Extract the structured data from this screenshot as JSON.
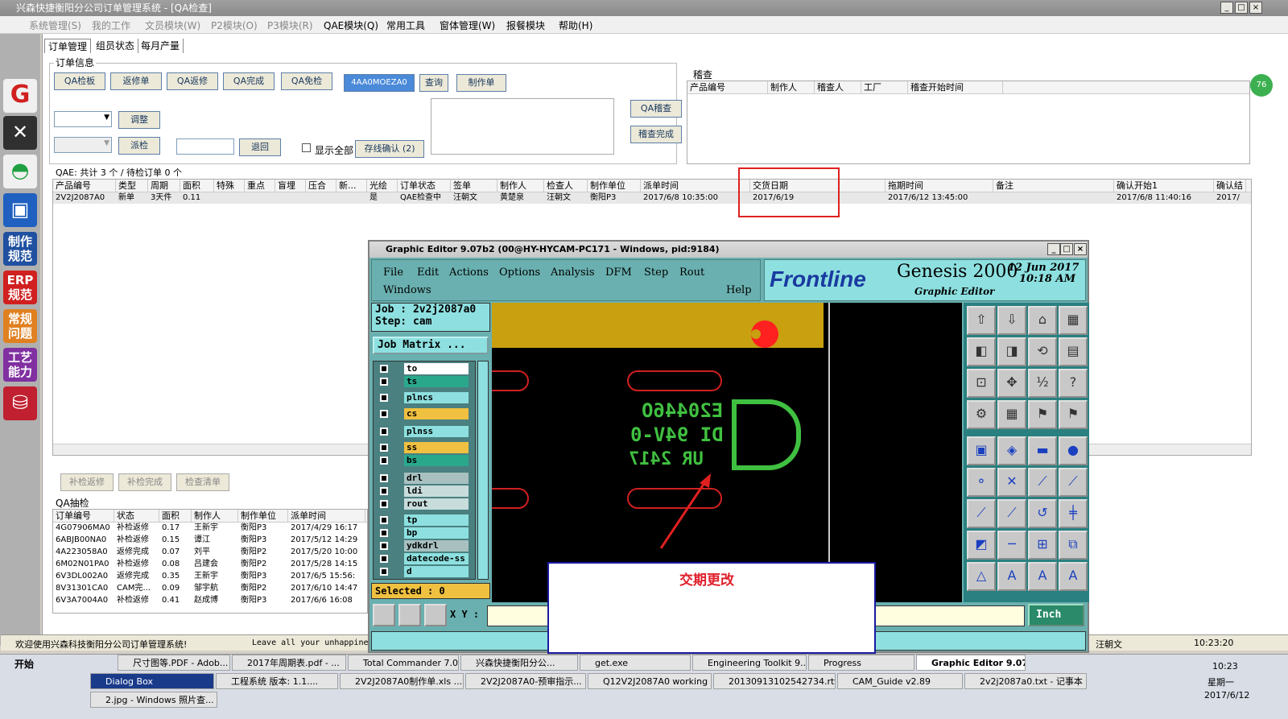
{
  "window": {
    "title": "兴森快捷衡阳分公司订单管理系统 - [QA检查]",
    "menus": [
      "系统管理(S)",
      "我的工作",
      "文员模块(W)",
      "P2模块(O)",
      "P3模块(R)",
      "QAE模块(Q)",
      "常用工具",
      "窗体管理(W)",
      "报餐模块",
      "帮助(H)"
    ]
  },
  "left_toolbar": {
    "items": [
      "制作规范",
      "ERP规范",
      "常规问题",
      "工艺能力"
    ]
  },
  "tabs": [
    "订单管理",
    "组员状态",
    "每月产量"
  ],
  "order_info": {
    "group_label": "订单信息",
    "buttons": [
      "QA检板",
      "返修单",
      "QA返修",
      "QA完成",
      "QA免检"
    ],
    "code_button": "4AA0MOEZA0",
    "query_button": "查询",
    "make_button": "制作单",
    "adjust_button": "调整",
    "dispatch_button": "派检",
    "return_button": "退回",
    "show_all_label": "显示全部",
    "confirm_button": "存线确认 (2)",
    "qa_review_button": "QA稽查",
    "review_done_button": "稽查完成"
  },
  "review": {
    "label": "稽查",
    "columns": [
      "产品编号",
      "制作人",
      "稽查人",
      "工厂",
      "稽查开始时间"
    ]
  },
  "qae_summary": "QAE: 共计 3 个 / 待检订单 0 个",
  "order_table": {
    "columns": [
      "产品编号",
      "类型",
      "周期",
      "面积",
      "特殊",
      "重点",
      "盲埋",
      "压合",
      "新...",
      "光绘",
      "订单状态",
      "签单",
      "制作人",
      "检查人",
      "制作单位",
      "派单时间",
      "交货日期",
      "拖期时间",
      "备注",
      "确认开始1",
      "确认结"
    ],
    "rows": [
      [
        "2V2J2087A0",
        "新单",
        "3天件",
        "0.11",
        "",
        "",
        "",
        "",
        "",
        "是",
        "QAE检查中",
        "汪朝文",
        "黄楚泉",
        "汪朝文",
        "衡阳P3",
        "2017/6/8 10:35:00",
        "2017/6/19",
        "2017/6/12 13:45:00",
        "",
        "2017/6/8 11:40:16",
        "2017/"
      ]
    ]
  },
  "bottom_buttons": [
    "补检返修",
    "补检完成",
    "检查清单"
  ],
  "qa_sampling": {
    "label": "QA抽检",
    "columns": [
      "订单编号",
      "状态",
      "面积",
      "制作人",
      "制作单位",
      "派单时间"
    ],
    "rows": [
      [
        "4G07906MA0",
        "补检返修",
        "0.17",
        "王新宇",
        "衡阳P3",
        "2017/4/29 16:17"
      ],
      [
        "6ABJB00NA0",
        "补检返修",
        "0.15",
        "谭江",
        "衡阳P3",
        "2017/5/12 14:29"
      ],
      [
        "4A223058A0",
        "返修完成",
        "0.07",
        "刘平",
        "衡阳P2",
        "2017/5/20 10:00"
      ],
      [
        "6M02N01PA0",
        "补检返修",
        "0.08",
        "吕建会",
        "衡阳P2",
        "2017/5/28 14:15"
      ],
      [
        "6V3DL002A0",
        "返修完成",
        "0.35",
        "王新宇",
        "衡阳P3",
        "2017/6/5 15:56:"
      ],
      [
        "8V31301CA0",
        "CAM完...",
        "0.09",
        "邹宇航",
        "衡阳P2",
        "2017/6/10 14:47"
      ],
      [
        "6V3A7004A0",
        "补检返修",
        "0.41",
        "赵成博",
        "衡阳P3",
        "2017/6/6 16:08"
      ]
    ]
  },
  "status_bar": {
    "welcome": "欢迎使用兴森科技衡阳分公司订单管理系统!",
    "message": "Leave all your unhappine",
    "user": "汪朝文",
    "time": "10:23:20"
  },
  "genesis": {
    "title": "Graphic Editor 9.07b2 (00@HY-HYCAM-PC171 - Windows, pid:9184)",
    "menu": [
      "File",
      "Edit",
      "Actions",
      "Options",
      "Analysis",
      "DFM",
      "Step",
      "Rout"
    ],
    "menu2": [
      "Windows",
      "Help"
    ],
    "brand": "Frontline",
    "product": "Genesis 2000",
    "subtitle": "Graphic Editor",
    "date": "12 Jun 2017",
    "clock": "10:18 AM",
    "job": "Job : 2v2j2087a0",
    "step": "Step: cam",
    "job_matrix": "Job Matrix ...",
    "layers": [
      {
        "name": "to",
        "color": "#ffffff"
      },
      {
        "name": "ts",
        "color": "#2aa88c"
      },
      {
        "name": "plncs",
        "color": "#8ee0e0"
      },
      {
        "name": "cs",
        "color": "#f0c040"
      },
      {
        "name": "plnss",
        "color": "#8ee0e0"
      },
      {
        "name": "ss",
        "color": "#f0c040"
      },
      {
        "name": "bs",
        "color": "#2aa88c"
      },
      {
        "name": "drl",
        "color": "#a8c0c0"
      },
      {
        "name": "ldi",
        "color": "#c8dcdc"
      },
      {
        "name": "rout",
        "color": "#c8dcdc"
      },
      {
        "name": "tp",
        "color": "#8ee0e0"
      },
      {
        "name": "bp",
        "color": "#8ee0e0"
      },
      {
        "name": "ydkdrl",
        "color": "#a8c0c0"
      },
      {
        "name": "datecode-ss",
        "color": "#8ee0e0"
      },
      {
        "name": "d",
        "color": "#8ee0e0"
      }
    ],
    "selected": "Selected : 0",
    "xy_label": "X Y :",
    "units": "Inch",
    "board_text": [
      "E20446O",
      "DI 94V-0",
      "UR 2417"
    ]
  },
  "annotation": {
    "text": "交期更改",
    "color": "#e0202c"
  },
  "taskbar": {
    "start": "开始",
    "row1": [
      "尺寸图等.PDF - Adob...",
      "2017年周期表.pdf - ...",
      "Total Commander 7.0...",
      "兴森快捷衡阳分公...",
      "get.exe",
      "Engineering Toolkit 9....",
      "Progress",
      "Graphic Editor 9.07..."
    ],
    "row2": [
      "Dialog Box",
      "工程系统  版本: 1.1....",
      "2V2J2087A0制作单.xls ...",
      "2V2J2087A0-预审指示...",
      "Q12V2J2087A0 working ...",
      "20130913102542734.rtf...",
      "CAM_Guide v2.89",
      "2v2j2087a0.txt - 记事本"
    ],
    "row3": [
      "2.jpg - Windows 照片查..."
    ],
    "clock": "10:23",
    "weekday": "星期一",
    "date": "2017/6/12"
  }
}
